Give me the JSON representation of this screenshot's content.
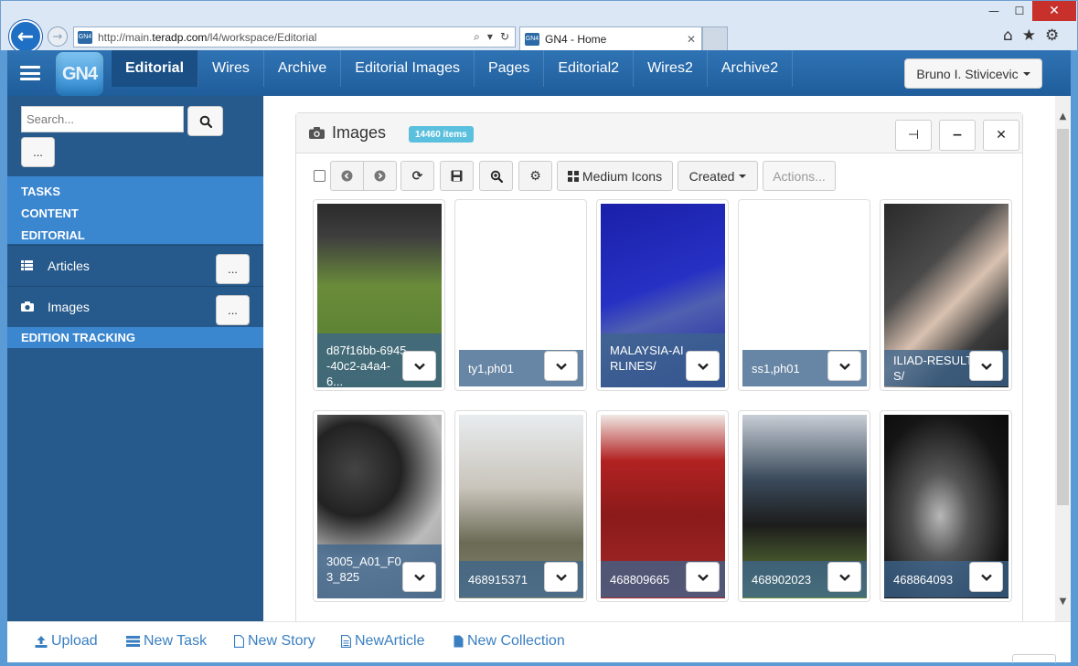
{
  "browser": {
    "url_prefix": "http://main.",
    "url_domain": "teradp.com",
    "url_path": "/l4/workspace/Editorial",
    "tab_title": "GN4 - Home",
    "favicon_text": "GN4"
  },
  "app": {
    "logo_text": "GN4",
    "nav": [
      {
        "label": "Editorial",
        "active": true
      },
      {
        "label": "Wires"
      },
      {
        "label": "Archive"
      },
      {
        "label": "Editorial Images"
      },
      {
        "label": "Pages"
      },
      {
        "label": "Editorial2"
      },
      {
        "label": "Wires2"
      },
      {
        "label": "Archive2"
      }
    ],
    "user": "Bruno I. Stivicevic"
  },
  "sidebar": {
    "search_placeholder": "Search...",
    "more_label": "...",
    "sections": [
      "TASKS",
      "CONTENT",
      "EDITORIAL"
    ],
    "items": [
      {
        "label": "Articles",
        "btn": "..."
      },
      {
        "label": "Images",
        "btn": "..."
      }
    ],
    "edition_tracking": "EDITION TRACKING"
  },
  "panel": {
    "title": "Images",
    "badge": "14460 items",
    "toolbar": {
      "view_mode": "Medium Icons",
      "sort": "Created",
      "actions": "Actions..."
    }
  },
  "images": [
    {
      "caption": "d87f16bb-6945-40c2-a4a4-6...",
      "style": "football"
    },
    {
      "caption": "ty1,ph01",
      "style": "blank"
    },
    {
      "caption": "MALAYSIA-AIRLINES/",
      "style": "blue"
    },
    {
      "caption": "ss1,ph01",
      "style": "blank"
    },
    {
      "caption": "ILIAD-RESULTS/",
      "style": "suit"
    },
    {
      "caption": "3005_A01_F03_825",
      "style": "bw"
    },
    {
      "caption": "468915371",
      "style": "flood"
    },
    {
      "caption": "468809665",
      "style": "red"
    },
    {
      "caption": "468902023",
      "style": "afl"
    },
    {
      "caption": "468864093",
      "style": "splash"
    }
  ],
  "footer": {
    "upload": "Upload",
    "new_task": "New Task",
    "new_story": "New Story",
    "new_article": "NewArticle",
    "new_collection": "New Collection"
  }
}
